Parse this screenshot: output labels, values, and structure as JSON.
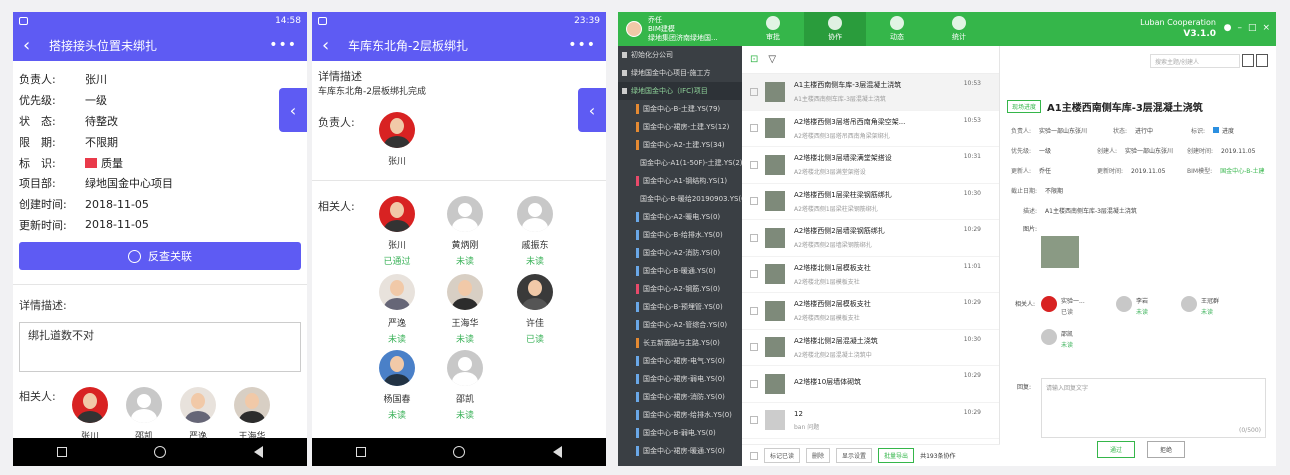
{
  "p1": {
    "time": "14:58",
    "title": "搭接接头位置未绑扎",
    "fields": [
      {
        "k": "负责人:",
        "v": "张川"
      },
      {
        "k": "优先级:",
        "v": "一级"
      },
      {
        "k": "状　态:",
        "v": "待整改"
      },
      {
        "k": "限　期:",
        "v": "不限期"
      },
      {
        "k": "标　识:",
        "v": "质量"
      },
      {
        "k": "项目部:",
        "v": "绿地国金中心项目"
      },
      {
        "k": "创建时间:",
        "v": "2018-11-05"
      },
      {
        "k": "更新时间:",
        "v": "2018-11-05"
      }
    ],
    "button": "反查关联",
    "desc_label": "详情描述:",
    "desc_value": "绑扎道数不对",
    "related_label": "相关人:",
    "related": [
      "张川",
      "邵凯",
      "严逸",
      "王海华"
    ]
  },
  "p2": {
    "time": "23:39",
    "title": "车库东北角-2层板绑扎",
    "desc_label": "详情描述",
    "desc_value": "车库东北角-2层板绑扎完成",
    "owner_label": "负责人:",
    "owner": "张川",
    "related_label": "相关人:",
    "related": [
      {
        "name": "张川",
        "status": "已通过"
      },
      {
        "name": "黄炳刚",
        "status": "未读"
      },
      {
        "name": "戚振东",
        "status": "未读"
      },
      {
        "name": "严逸",
        "status": "未读"
      },
      {
        "name": "王海华",
        "status": "未读"
      },
      {
        "name": "许佳",
        "status": "已读"
      },
      {
        "name": "杨国春",
        "status": "未读"
      },
      {
        "name": "邵凯",
        "status": "未读"
      }
    ]
  },
  "pc": {
    "user_name": "乔任",
    "user_role": "BIM建模",
    "user_org": "绿地集团济南绿地国...",
    "nav": [
      "审批",
      "协作",
      "动态",
      "统计"
    ],
    "brand": "Luban Cooperation",
    "version": "V3.1.0",
    "tree": [
      "初始化分公司",
      "绿地国金中心项目-施工方",
      "绿地国金中心（IFC)项目",
      "国金中心-B-土建.YS(79)",
      "国金中心-裙房-土建.YS(12)",
      "国金中心-A2-土建.YS(34)",
      "国金中心-A1(1-50F)-土建.YS(2)",
      "国金中心-A1-钢结构.YS(1)",
      "国金中心-B-暖给20190903.YS(0)",
      "国金中心-A2-暖电.YS(0)",
      "国金中心-B-给排水.YS(0)",
      "国金中心-A2-消防.YS(0)",
      "国金中心-B-暖通.YS(0)",
      "国金中心-A2-钢筋.YS(0)",
      "国金中心-B-预埋管.YS(0)",
      "国金中心-A2-管综合.YS(0)",
      "长五新面路与主路.YS(0)",
      "国金中心-裙房-电气.YS(0)",
      "国金中心-裙房-弱电.YS(0)",
      "国金中心-裙房-消防.YS(0)",
      "国金中心-裙房-给排水.YS(0)",
      "国金中心-B-弱电.YS(0)",
      "国金中心-裙房-暖通.YS(0)"
    ],
    "list": [
      {
        "t": "A1主楼西南侧车库-3层混凝土浇筑",
        "s": "A1主楼西南侧车库-3层混凝土浇筑",
        "tm": "10:53"
      },
      {
        "t": "A2塔楼西侧3层塔吊西南角梁空架...",
        "s": "A2塔楼西侧3层塔吊西南角梁架绑扎",
        "tm": "10:53"
      },
      {
        "t": "A2塔楼北侧3层墙梁满堂架搭设",
        "s": "A2塔楼北侧3层满堂架搭设",
        "tm": "10:31"
      },
      {
        "t": "A2塔楼西侧1层梁柱梁钢筋绑扎",
        "s": "A2塔楼西侧1层梁柱梁钢筋绑扎",
        "tm": "10:30"
      },
      {
        "t": "A2塔楼西侧2层墙梁钢筋绑扎",
        "s": "A2塔楼西侧2层墙梁钢筋绑扎",
        "tm": "10:29"
      },
      {
        "t": "A2塔楼北侧1层模板支社",
        "s": "A2塔楼北侧1层模板支社",
        "tm": "11:01"
      },
      {
        "t": "A2塔楼西侧2层模板支社",
        "s": "A2塔楼西侧2层模板支社",
        "tm": "10:29"
      },
      {
        "t": "A2塔楼北侧2层混凝土浇筑",
        "s": "A2塔楼北侧2层混凝土浇筑中",
        "tm": "10:30"
      },
      {
        "t": "A2塔楼10层墙体砌筑",
        "s": "",
        "tm": "10:29"
      },
      {
        "t": "12",
        "s": "ban 问题",
        "tm": "10:29"
      }
    ],
    "bottom": [
      "标记已读",
      "删除",
      "显示设置",
      "批量导出"
    ],
    "total": "共193条协作",
    "search_placeholder": "搜索主题/创建人",
    "detail": {
      "tag": "现场进度",
      "title": "A1主楼西南侧车库-3层混凝土浇筑",
      "owner_k": "负责人:",
      "owner_v": "实验一部山东张川",
      "status_k": "状态:",
      "status_v": "进行中",
      "mark_k": "标识:",
      "mark_v": "进度",
      "priority_k": "优先级:",
      "priority_v": "一级",
      "creator_k": "创建人:",
      "creator_v": "实验一部山东张川",
      "ctime_k": "创建时间:",
      "ctime_v": "2019.11.05",
      "updater_k": "更新人:",
      "updater_v": "乔任",
      "utime_k": "更新时间:",
      "utime_v": "2019.11.05",
      "bim_k": "BIM模型:",
      "bim_v": "国金中心-B-土建",
      "deadline_k": "截止日期:",
      "deadline_v": "不限期",
      "desc_k": "描述:",
      "desc_v": "A1主楼西南侧车库-3层混凝土浇筑",
      "pic_k": "图片:",
      "related_k": "相关人:",
      "related": [
        {
          "name": "实验一...",
          "status": "已读"
        },
        {
          "name": "李岩",
          "status": "未读"
        },
        {
          "name": "王冠群",
          "status": "未读"
        },
        {
          "name": "邵凯",
          "status": "未读"
        }
      ],
      "reply_k": "回复:",
      "reply_placeholder": "请输入回复文字",
      "counter": "(0/500)",
      "ok": "通过",
      "reject": "拒绝"
    }
  }
}
